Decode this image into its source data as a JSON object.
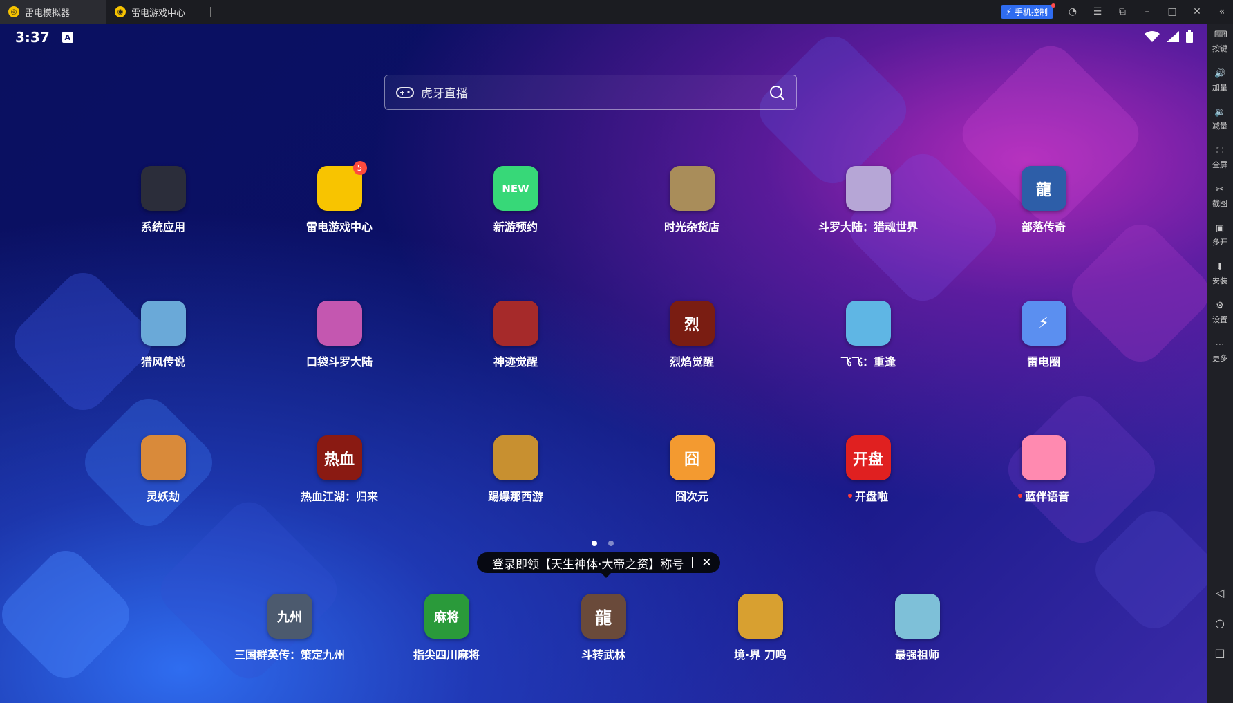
{
  "titlebar": {
    "tabs": [
      {
        "label": "雷电模拟器",
        "icon": "leidian-logo-icon"
      },
      {
        "label": "雷电游戏中心",
        "icon": "gamepad-icon"
      }
    ],
    "phone_control_label": "手机控制"
  },
  "status": {
    "time": "3:37",
    "notice_icon_letter": "A"
  },
  "search": {
    "placeholder": "虎牙直播"
  },
  "apps": [
    {
      "label": "系统应用",
      "color": "#2b2d3a",
      "text": ""
    },
    {
      "label": "雷电游戏中心",
      "color": "#f8c400",
      "text": "",
      "badge": "5"
    },
    {
      "label": "新游预约",
      "color": "#37d878",
      "text": "NEW"
    },
    {
      "label": "时光杂货店",
      "color": "#a98d5a",
      "text": ""
    },
    {
      "label": "斗罗大陆：猎魂世界",
      "color": "#b6a6d6",
      "text": ""
    },
    {
      "label": "部落传奇",
      "color": "#2d5ea8",
      "text": "龍"
    },
    {
      "label": "猎风传说",
      "color": "#6aa9d8",
      "text": ""
    },
    {
      "label": "口袋斗罗大陆",
      "color": "#c457b0",
      "text": ""
    },
    {
      "label": "神迹觉醒",
      "color": "#a62a2a",
      "text": ""
    },
    {
      "label": "烈焰觉醒",
      "color": "#7a1d12",
      "text": "烈"
    },
    {
      "label": "飞飞：重逢",
      "color": "#5fb6e4",
      "text": ""
    },
    {
      "label": "雷电圈",
      "color": "#5b8ff0",
      "text": "⚡"
    },
    {
      "label": "灵妖劫",
      "color": "#d98a3a",
      "text": ""
    },
    {
      "label": "热血江湖：归来",
      "color": "#8a1a12",
      "text": "热血"
    },
    {
      "label": "踢爆那西游",
      "color": "#c89030",
      "text": ""
    },
    {
      "label": "囧次元",
      "color": "#f39a30",
      "text": "囧"
    },
    {
      "label": "开盘啦",
      "color": "#e02020",
      "text": "开盘",
      "dot": true
    },
    {
      "label": "蓝伴语音",
      "color": "#ff8ab0",
      "text": "",
      "dot": true
    }
  ],
  "dock": [
    {
      "label": "三国群英传：策定九州",
      "color": "#4c5a6e",
      "text": "九州"
    },
    {
      "label": "指尖四川麻将",
      "color": "#2a9a3a",
      "text": "麻将"
    },
    {
      "label": "斗转武林",
      "color": "#6a4a3a",
      "text": "龍"
    },
    {
      "label": "境·界 刀鸣",
      "color": "#d8a030",
      "text": ""
    },
    {
      "label": "最强祖师",
      "color": "#7ec0d8",
      "text": ""
    }
  ],
  "promo": {
    "text": "登录即领【天生神体·大帝之资】称号",
    "close": "✕"
  },
  "sidebar": {
    "items": [
      {
        "label": "按键",
        "icon": "keyboard-icon",
        "glyph": "⌨"
      },
      {
        "label": "加量",
        "icon": "volume-up-icon",
        "glyph": "🔊"
      },
      {
        "label": "减量",
        "icon": "volume-down-icon",
        "glyph": "🔉"
      },
      {
        "label": "全屏",
        "icon": "fullscreen-icon",
        "glyph": "⛶"
      },
      {
        "label": "截图",
        "icon": "scissors-icon",
        "glyph": "✂"
      },
      {
        "label": "多开",
        "icon": "multi-instance-icon",
        "glyph": "▣"
      },
      {
        "label": "安装",
        "icon": "install-icon",
        "glyph": "⬇"
      },
      {
        "label": "设置",
        "icon": "gear-icon",
        "glyph": "⚙"
      },
      {
        "label": "更多",
        "icon": "more-icon",
        "glyph": "⋯"
      }
    ]
  }
}
